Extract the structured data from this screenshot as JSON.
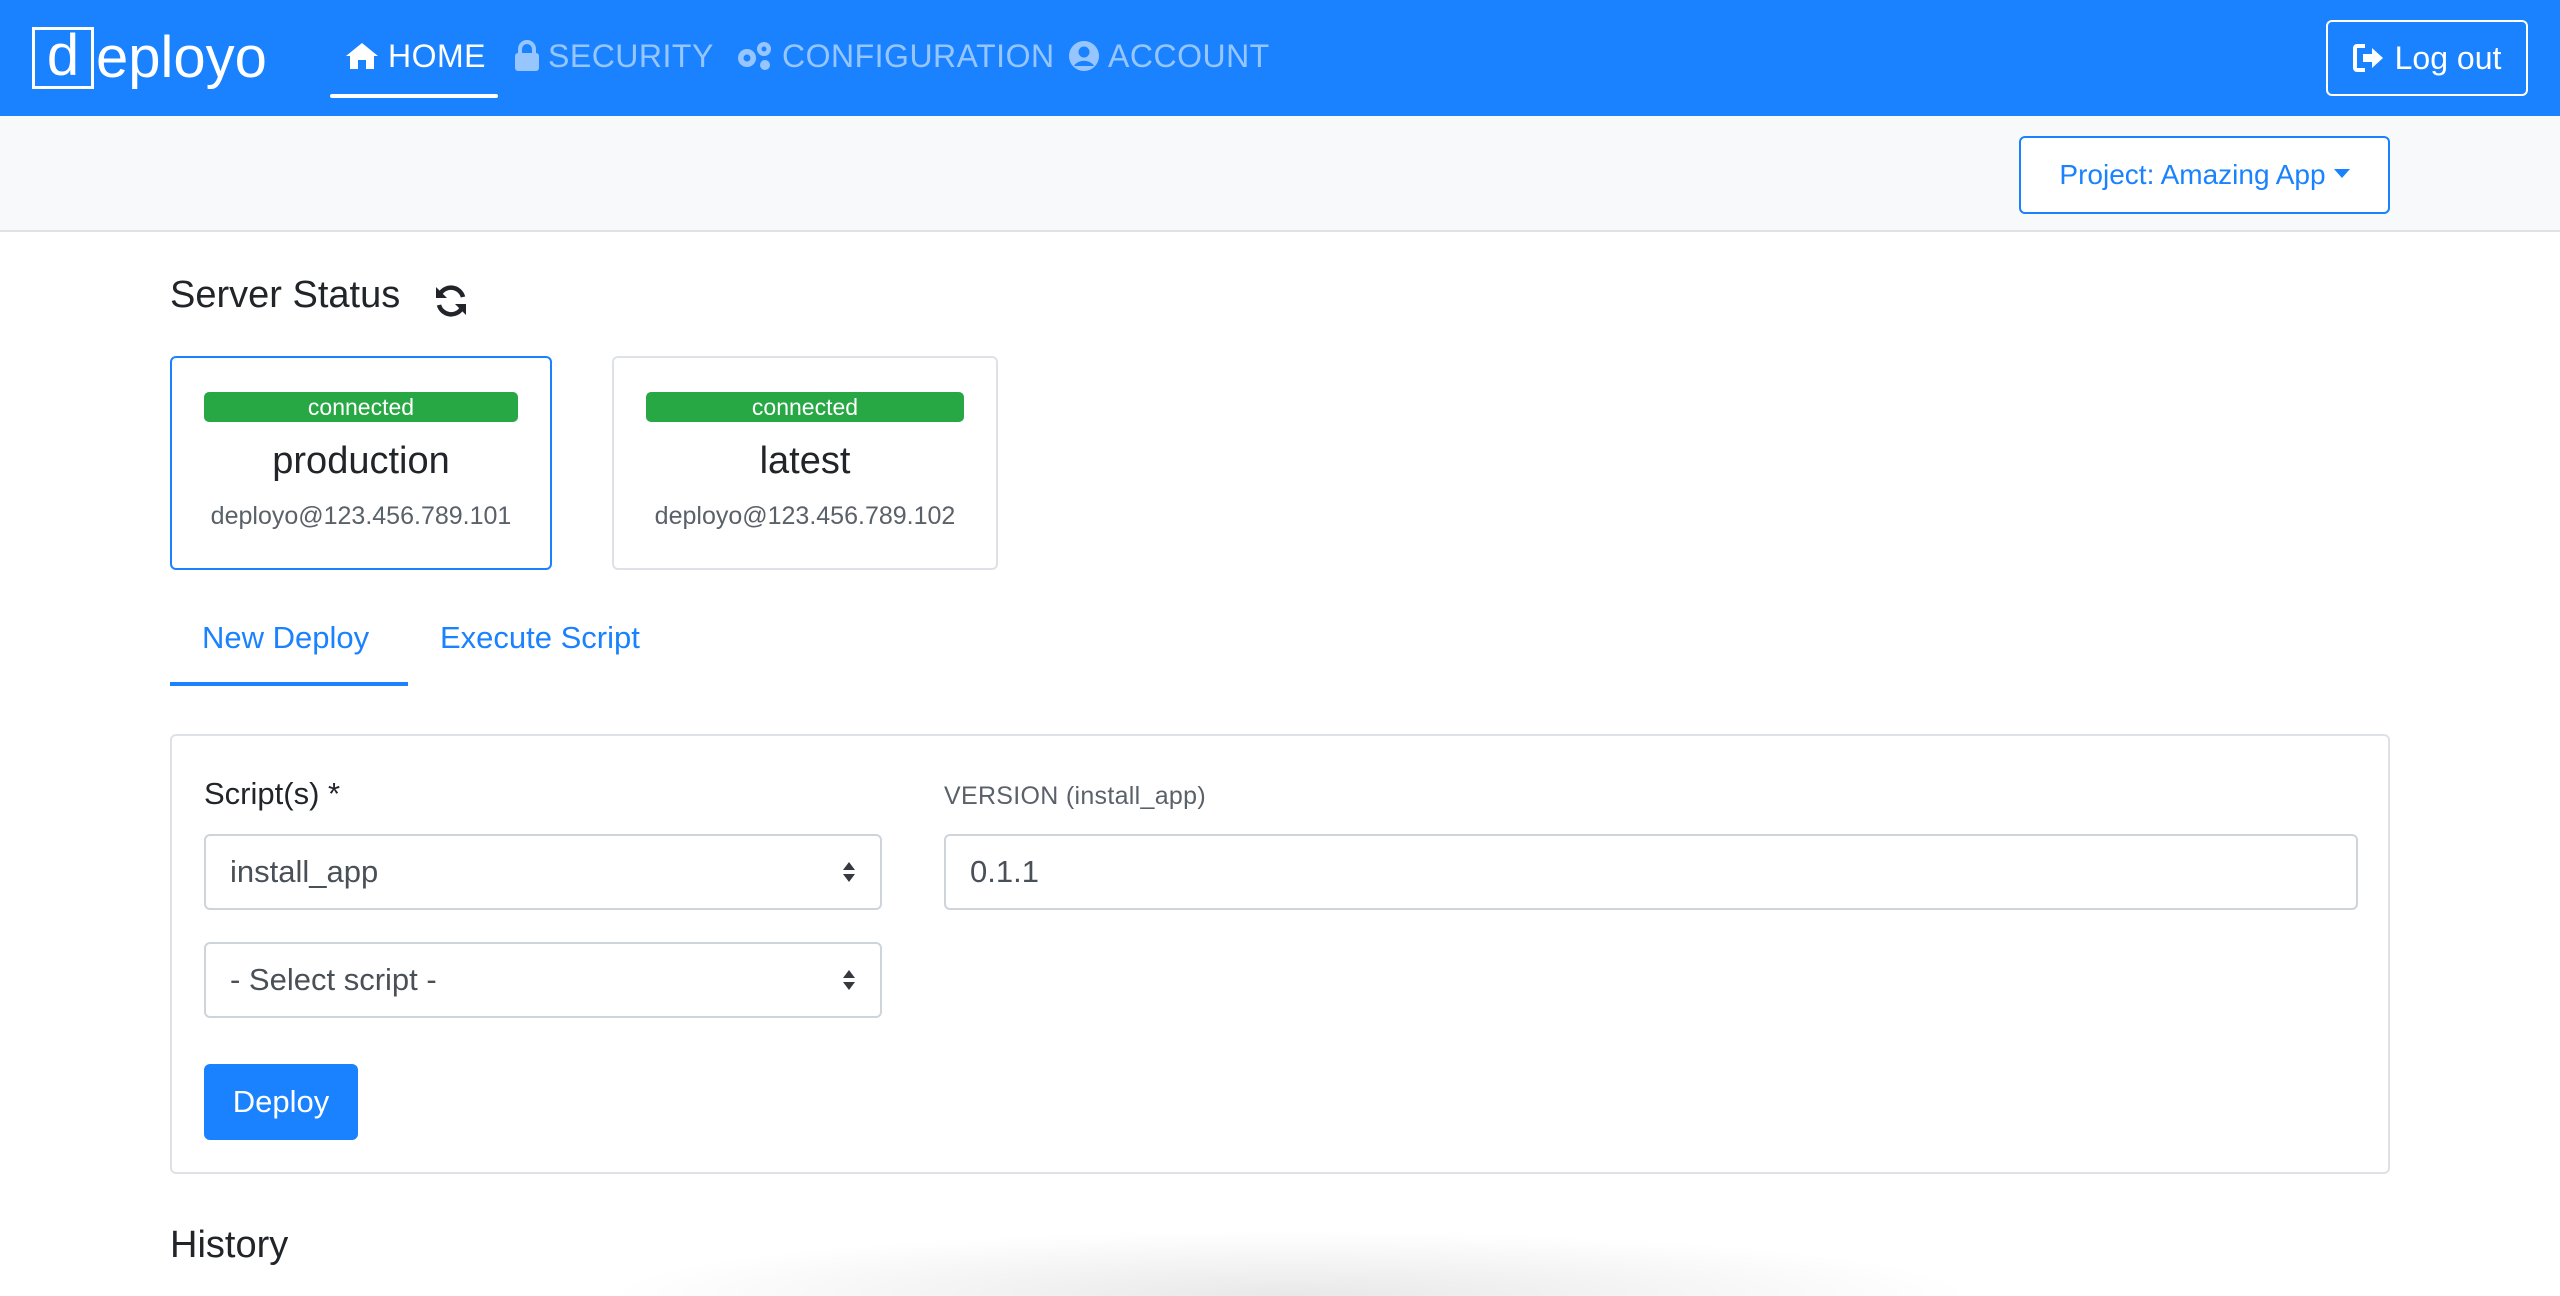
{
  "brand": {
    "logo_letter": "d",
    "logo_rest": "eployo"
  },
  "nav": {
    "items": [
      {
        "label": "HOME",
        "icon": "home-icon",
        "active": true
      },
      {
        "label": "SECURITY",
        "icon": "lock-icon",
        "active": false
      },
      {
        "label": "CONFIGURATION",
        "icon": "gears-icon",
        "active": false
      },
      {
        "label": "ACCOUNT",
        "icon": "user-circle-icon",
        "active": false
      }
    ],
    "logout_label": "Log out"
  },
  "project": {
    "label": "Project: Amazing App"
  },
  "server_status": {
    "title": "Server Status",
    "servers": [
      {
        "status": "connected",
        "name": "production",
        "host": "deployo@123.456.789.101",
        "selected": true
      },
      {
        "status": "connected",
        "name": "latest",
        "host": "deployo@123.456.789.102",
        "selected": false
      }
    ]
  },
  "tabs": [
    {
      "label": "New Deploy",
      "active": true
    },
    {
      "label": "Execute Script",
      "active": false
    }
  ],
  "deploy_form": {
    "scripts_label": "Script(s) *",
    "script_selected": "install_app",
    "script_placeholder": "- Select script -",
    "version_label": "VERSION (install_app)",
    "version_value": "0.1.1",
    "deploy_label": "Deploy"
  },
  "history": {
    "title": "History"
  },
  "colors": {
    "primary": "#1a82ff",
    "success": "#28a745",
    "subbar": "#f8f9fa"
  }
}
